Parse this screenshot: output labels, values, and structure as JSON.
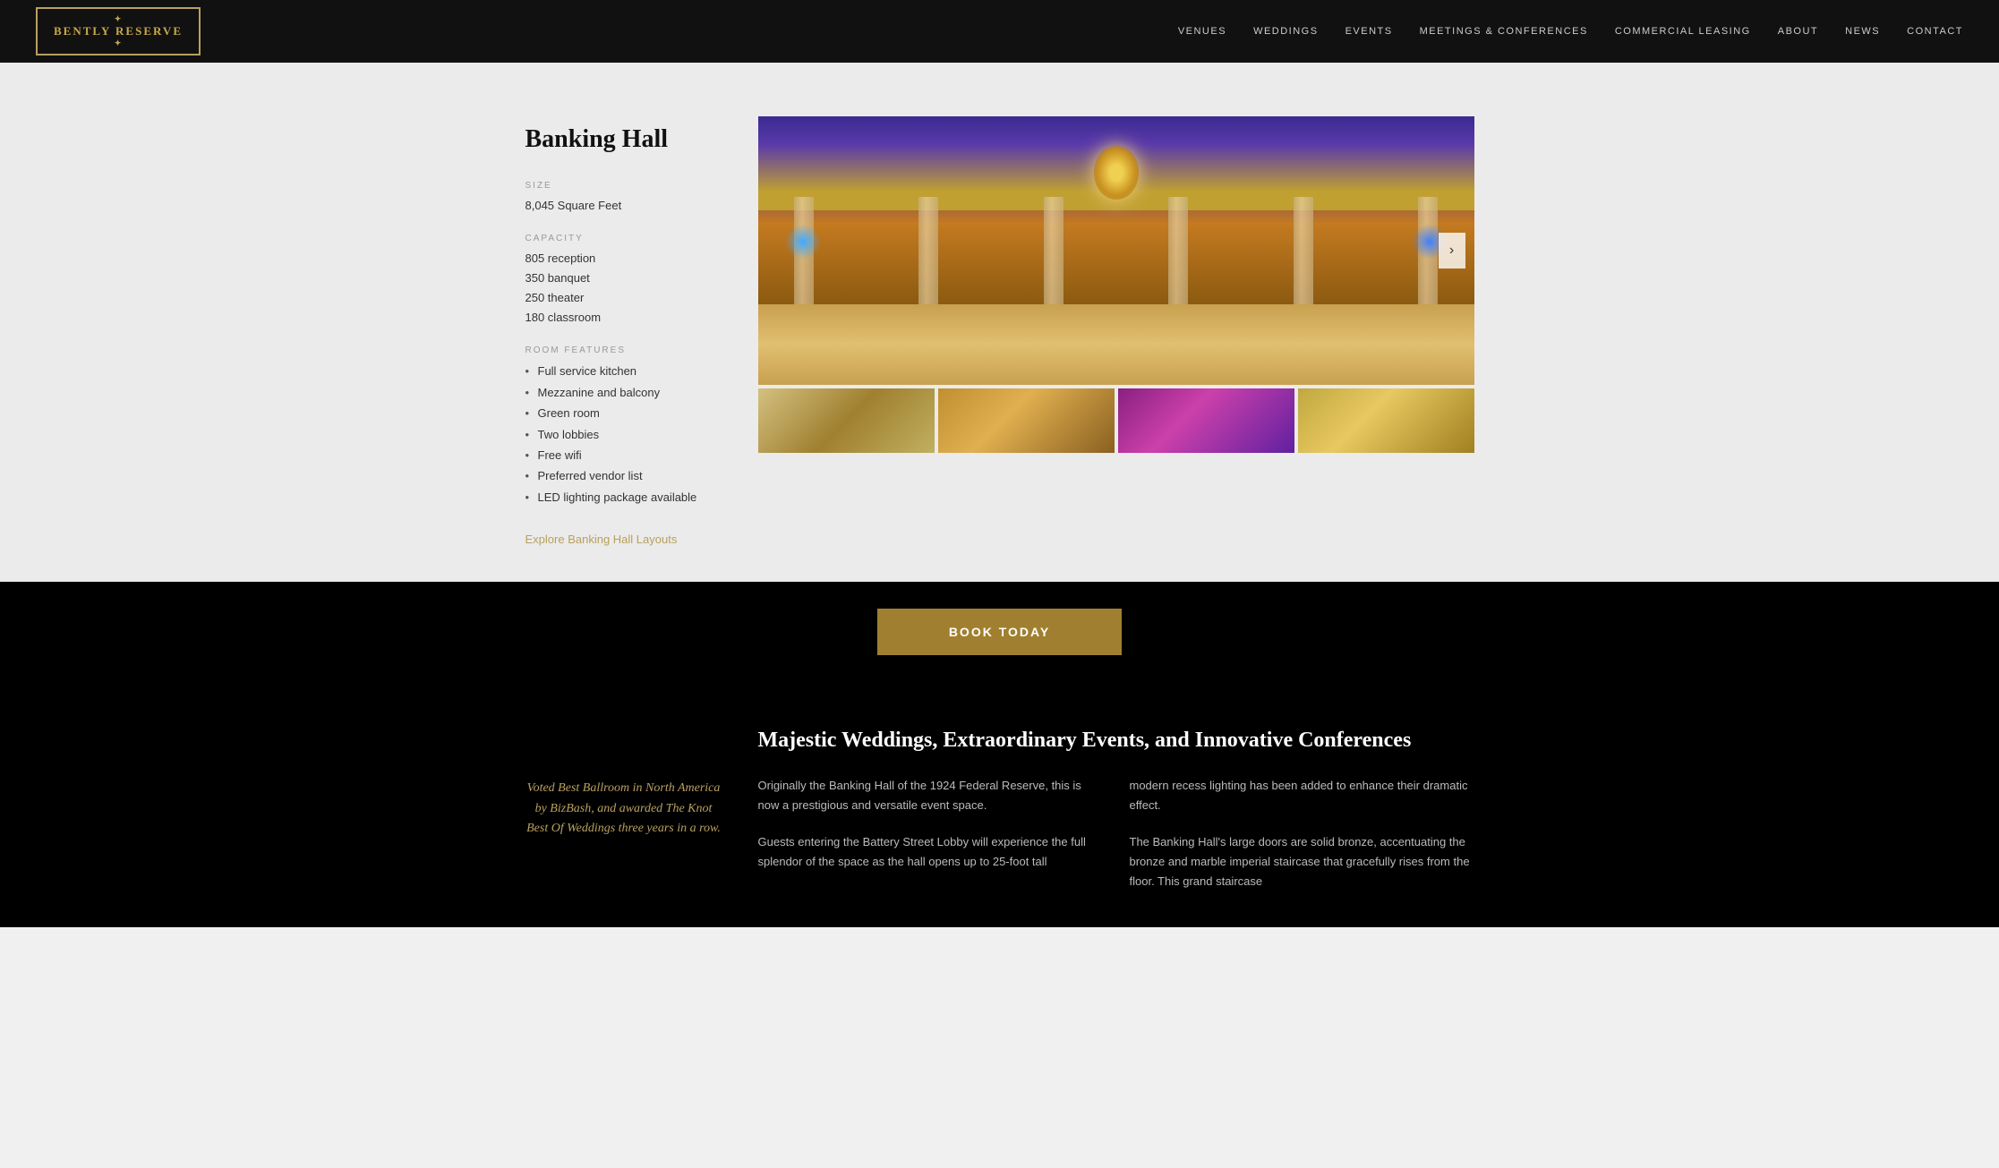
{
  "header": {
    "logo": "BENTLY RESERVE",
    "logo_sub": "★",
    "nav": [
      {
        "label": "VENUES",
        "id": "venues"
      },
      {
        "label": "WEDDINGS",
        "id": "weddings"
      },
      {
        "label": "EVENTS",
        "id": "events"
      },
      {
        "label": "MEETINGS & CONFERENCES",
        "id": "meetings"
      },
      {
        "label": "COMMERCIAL LEASING",
        "id": "commercial"
      },
      {
        "label": "ABOUT",
        "id": "about"
      },
      {
        "label": "NEWS",
        "id": "news"
      },
      {
        "label": "CONTACT",
        "id": "contact"
      }
    ]
  },
  "venue": {
    "title": "Banking Hall",
    "size_label": "SIZE",
    "size_value": "8,045 Square Feet",
    "capacity_label": "CAPACITY",
    "capacity_items": [
      "805 reception",
      "350 banquet",
      "250 theater",
      "180 classroom"
    ],
    "features_label": "ROOM FEATURES",
    "features_items": [
      "Full service kitchen",
      "Mezzanine and balcony",
      "Green room",
      "Two lobbies",
      "Free wifi",
      "Preferred vendor list",
      "LED lighting package available"
    ],
    "explore_link": "Explore Banking Hall Layouts"
  },
  "book": {
    "label": "BOOK TODAY"
  },
  "bottom": {
    "award_text": "Voted Best Ballroom in North America by BizBash, and awarded The Knot Best Of Weddings three years in a row.",
    "title": "Majestic Weddings, Extraordinary Events, and Innovative Conferences",
    "col1_text": "Originally the Banking Hall of the 1924 Federal Reserve, this is now a prestigious and versatile event space.\n\nGuests entering the Battery Street Lobby will experience the full splendor of the space as the hall opens up to 25-foot tall",
    "col2_text": "modern recess lighting has been added to enhance their dramatic effect.\n\nThe Banking Hall's large doors are solid bronze, accentuating the bronze and marble imperial staircase that gracefully rises from the floor. This grand staircase"
  }
}
